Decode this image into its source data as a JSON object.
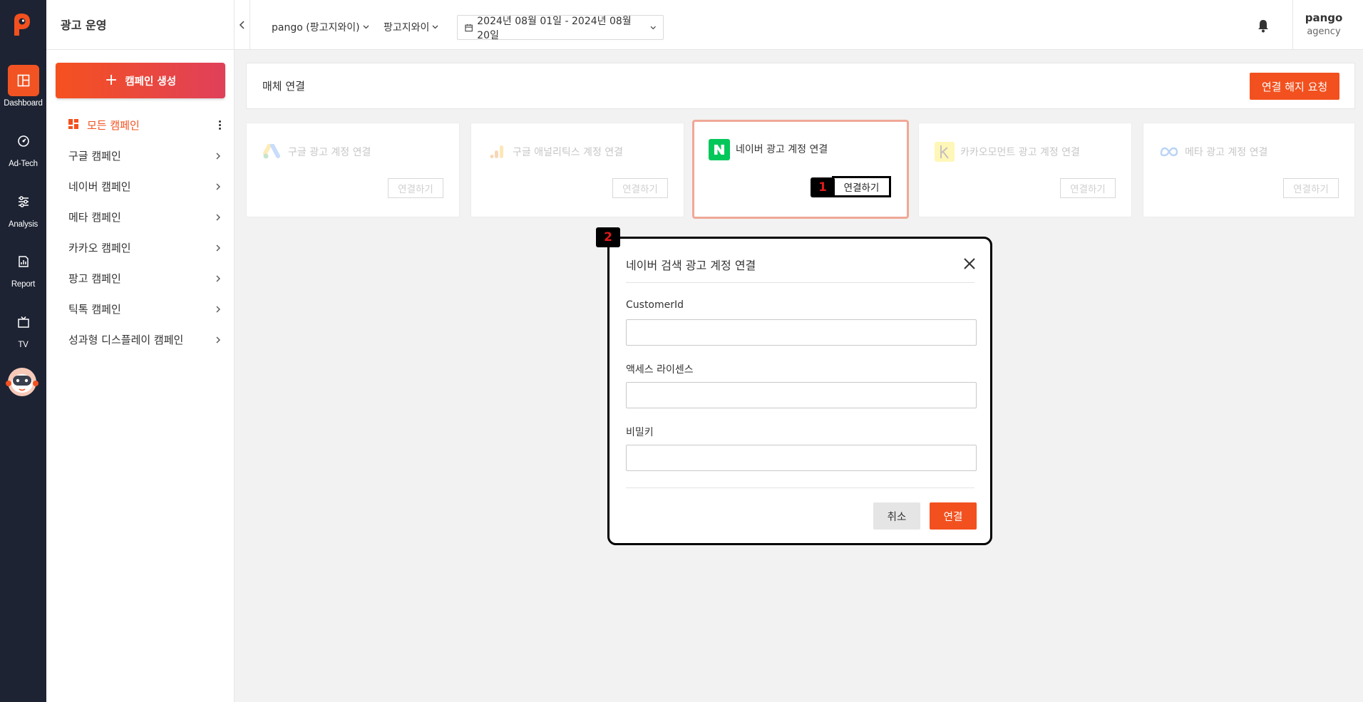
{
  "rail": {
    "items": [
      {
        "label": "Dashboard",
        "icon": "dashboard-icon"
      },
      {
        "label": "Ad-Tech",
        "icon": "gauge-icon"
      },
      {
        "label": "Analysis",
        "icon": "sliders-icon"
      },
      {
        "label": "Report",
        "icon": "report-icon"
      },
      {
        "label": "TV",
        "icon": "tv-icon"
      }
    ]
  },
  "sidebar": {
    "title": "광고 운영",
    "create_label": "캠페인 생성",
    "items": [
      {
        "label": "모든 캠페인"
      },
      {
        "label": "구글 캠페인"
      },
      {
        "label": "네이버 캠페인"
      },
      {
        "label": "메타 캠페인"
      },
      {
        "label": "카카오 캠페인"
      },
      {
        "label": "팡고 캠페인"
      },
      {
        "label": "틱톡 캠페인"
      },
      {
        "label": "성과형 디스플레이 캠페인"
      }
    ]
  },
  "topbar": {
    "account_select": "pango (팡고지와이)",
    "org_select": "팡고지와이",
    "date_range": "2024년 08월 01일 - 2024년 08월 20일",
    "user_name": "pango",
    "user_org": "agency"
  },
  "panel": {
    "title": "매체 연결",
    "disconnect_label": "연결 해지 요청"
  },
  "cards": [
    {
      "title": "구글 광고 계정 연결",
      "button": "연결하기",
      "icon": "google-ads-icon"
    },
    {
      "title": "구글 애널리틱스 계정 연결",
      "button": "연결하기",
      "icon": "google-analytics-icon"
    },
    {
      "title": "네이버 광고 계정 연결",
      "button": "연결하기",
      "icon": "naver-icon"
    },
    {
      "title": "카카오모먼트 광고 계정 연결",
      "button": "연결하기",
      "icon": "kakao-moment-icon"
    },
    {
      "title": "메타 광고 계정 연결",
      "button": "연결하기",
      "icon": "meta-icon"
    }
  ],
  "badges": {
    "one": "1",
    "two": "2"
  },
  "modal": {
    "title": "네이버 검색 광고 계정 연결",
    "fields": [
      {
        "label": "CustomerId",
        "value": ""
      },
      {
        "label": "액세스 라이센스",
        "value": ""
      },
      {
        "label": "비밀키",
        "value": ""
      }
    ],
    "cancel_label": "취소",
    "connect_label": "연결"
  },
  "colors": {
    "accent": "#f2511f",
    "rail_bg": "#1d2333",
    "naver_green": "#03c75a"
  }
}
